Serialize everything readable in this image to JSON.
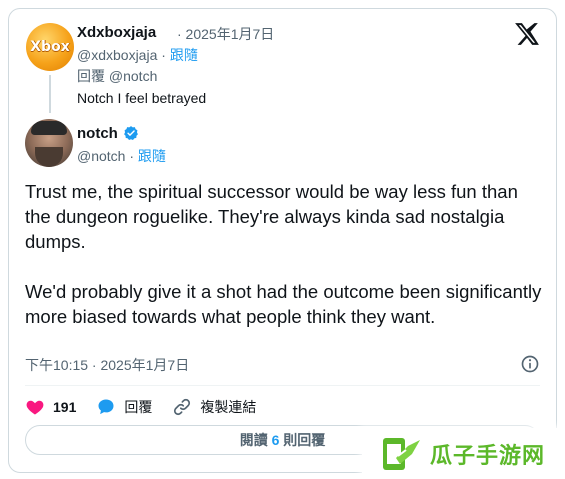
{
  "parent_tweet": {
    "avatar_text": "Xbox",
    "display_name": "Xdxboxjaja",
    "date": "· 2025年1月7日",
    "handle": "@xdxboxjaja",
    "follow": "跟隨",
    "reply_prefix": "回覆",
    "reply_to": "@notch",
    "text": "Notch I feel betrayed"
  },
  "main_tweet": {
    "display_name": "notch",
    "handle": "@notch",
    "follow": "跟隨",
    "paragraphs": [
      "Trust me, the spiritual successor would be way less fun than the dungeon roguelike. They're always kinda sad nostalgia dumps.",
      "We'd probably give it a shot had the outcome been significantly more biased towards what people think they want."
    ],
    "timestamp": "下午10:15 · 2025年1月7日"
  },
  "actions": {
    "like_count": "191",
    "reply_label": "回覆",
    "copy_link_label": "複製連結"
  },
  "read_replies": {
    "prefix": "閱讀",
    "count": "6",
    "suffix": "則回覆"
  },
  "watermark": {
    "text": "瓜子手游网"
  },
  "colors": {
    "accent_blue": "#1d9bf0",
    "like_pink": "#f91880",
    "muted": "#536471",
    "watermark_green": "#5cb82a"
  }
}
